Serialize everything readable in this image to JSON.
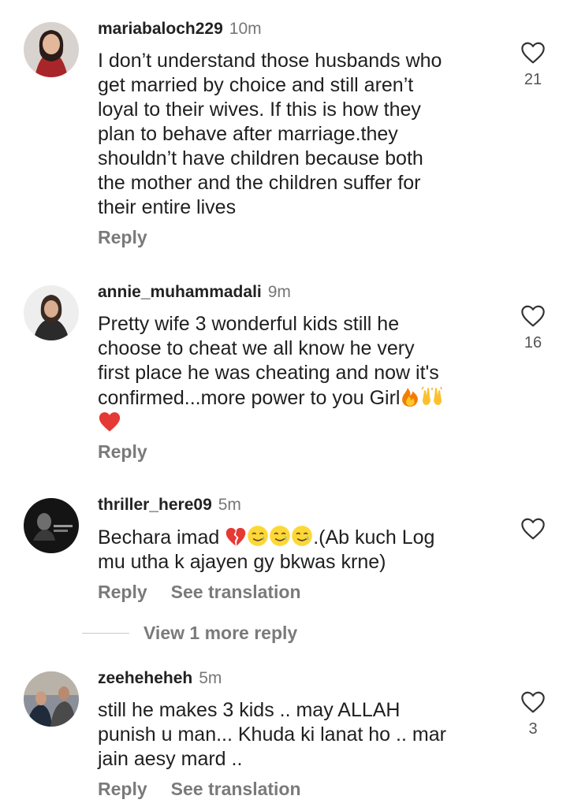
{
  "comments": [
    {
      "username": "mariabaloch229",
      "time": "10m",
      "text_lines": [
        "I don’t understand those husbands who",
        "get married by choice and still aren’t",
        "loyal to their wives. If this is how they",
        "plan to behave after marriage.they",
        "shouldn’t have children because both",
        "the mother and the children suffer for",
        "their entire lives"
      ],
      "reply": "Reply",
      "likes": "21"
    },
    {
      "username": "annie_muhammadali",
      "time": "9m",
      "text_lines": [
        "Pretty wife 3 wonderful kids still he",
        "choose to cheat we all know he very",
        "first place he was cheating and now it's",
        "confirmed...more power to you Girl"
      ],
      "emojis": [
        "fire-emoji",
        "raised-hands-emoji",
        "red-heart-emoji"
      ],
      "reply": "Reply",
      "likes": "16"
    },
    {
      "username": "thriller_here09",
      "time": "5m",
      "text_prefix": "Bechara imad ",
      "text_suffix": ".(Ab kuch Log",
      "text_line2": "mu utha k ajayen gy bkwas krne)",
      "emojis": [
        "broken-heart-emoji",
        "smiling-tear-emoji",
        "smiling-tear-emoji",
        "smiling-tear-emoji"
      ],
      "reply": "Reply",
      "translate": "See translation"
    },
    {
      "username": "zeeheheheh",
      "time": "5m",
      "text_lines": [
        "still he makes 3 kids .. may ALLAH",
        "punish u man... Khuda ki lanat ho .. mar",
        "jain aesy mard .."
      ],
      "reply": "Reply",
      "translate": "See translation",
      "likes": "3"
    }
  ],
  "view_more": "View 1 more reply",
  "colors": {
    "muted": "#7a7a7a",
    "text": "#1f1f1f",
    "heart_outline": "#333333"
  }
}
